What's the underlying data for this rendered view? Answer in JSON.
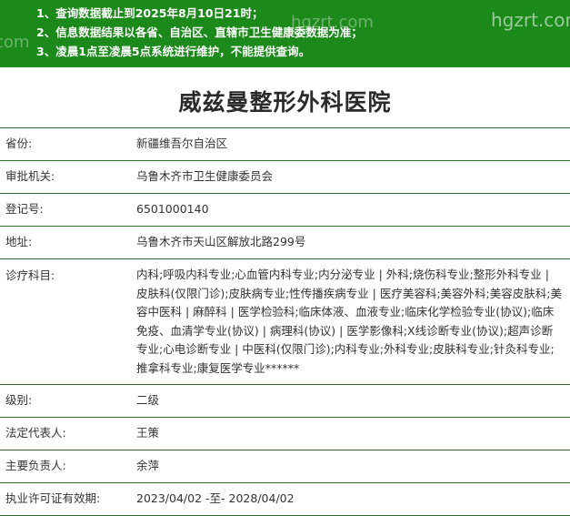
{
  "notice": {
    "lines": [
      "1、查询数据截止到2025年8月10日21时；",
      "2、信息数据结果以各省、自治区、直辖市卫生健康委数据为准；",
      "3、凌晨1点至凌晨5点系统进行维护，不能提供查询。"
    ],
    "watermarks": [
      "hgzrt.com",
      "hgzrt.com",
      "com"
    ]
  },
  "title": "威兹曼整形外科医院",
  "fields": {
    "province": {
      "label": "省份:",
      "value": "新疆维吾尔自治区"
    },
    "authority": {
      "label": "审批机关:",
      "value": "乌鲁木齐市卫生健康委员会"
    },
    "reg_no": {
      "label": "登记号:",
      "value": "6501000140"
    },
    "address": {
      "label": "地址:",
      "value": "乌鲁木齐市天山区解放北路299号"
    },
    "scope": {
      "label": "诊疗科目:",
      "value": "内科;呼吸内科专业;心血管内科专业;内分泌专业 | 外科;烧伤科专业;整形外科专业 | 皮肤科(仅限门诊);皮肤病专业;性传播疾病专业 | 医疗美容科;美容外科;美容皮肤科;美容中医科 | 麻醉科 | 医学检验科;临床体液、血液专业;临床化学检验专业(协议);临床免疫、血清学专业(协议) | 病理科(协议) | 医学影像科;X线诊断专业(协议);超声诊断专业;心电诊断专业 | 中医科(仅限门诊);内科专业;外科专业;皮肤科专业;针灸科专业;推拿科专业;康复医学专业******"
    },
    "level": {
      "label": "级别:",
      "value": "二级"
    },
    "legal_rep": {
      "label": "法定代表人:",
      "value": "王策"
    },
    "principal": {
      "label": "主要负责人:",
      "value": "余萍"
    },
    "validity": {
      "label": "执业许可证有效期:",
      "value": "2023/04/02 -至- 2028/04/02"
    }
  },
  "colors": {
    "header_bg": "#1c8a1a",
    "row_border": "#2e6f2c"
  }
}
